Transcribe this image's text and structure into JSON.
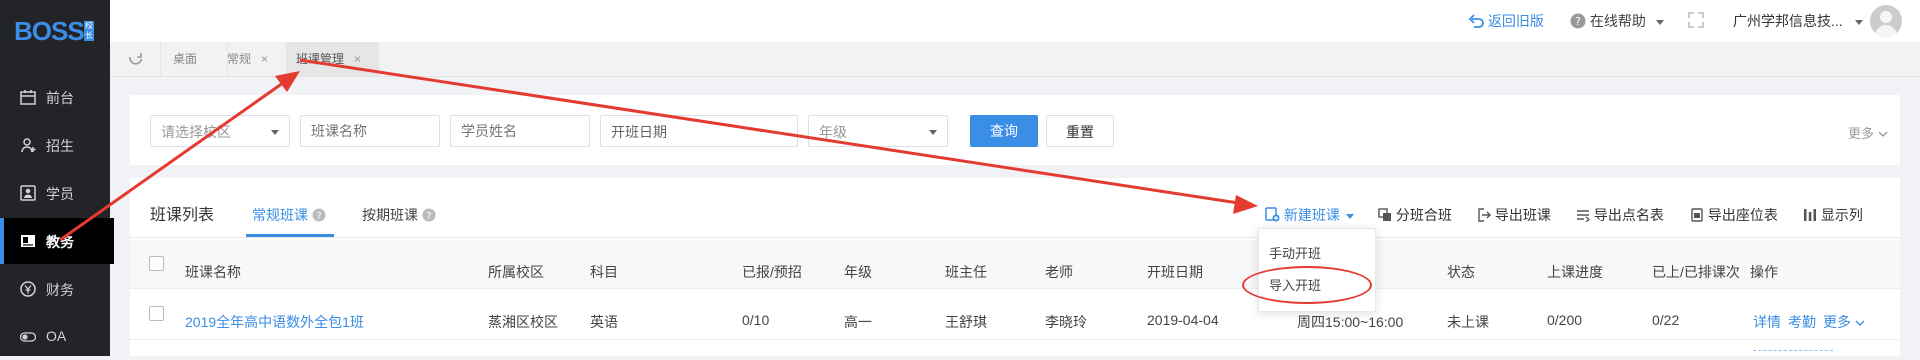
{
  "brand": {
    "logo": "BOSS",
    "seal": "校长",
    "accent": "#3a8ee6"
  },
  "sidebar": {
    "items": [
      {
        "label": "前台",
        "icon": "calendar-icon"
      },
      {
        "label": "招生",
        "icon": "user-add-icon"
      },
      {
        "label": "学员",
        "icon": "student-icon"
      },
      {
        "label": "教务",
        "icon": "academic-icon",
        "active": true
      },
      {
        "label": "财务",
        "icon": "finance-icon"
      },
      {
        "label": "OA",
        "icon": "toggle-icon"
      }
    ]
  },
  "header": {
    "back_label": "返回旧版",
    "help_label": "在线帮助",
    "org_name": "广州学邦信息技..."
  },
  "tabs": [
    {
      "label": "桌面"
    },
    {
      "label": "常规",
      "close": "×"
    },
    {
      "label": "班课管理",
      "close": "×"
    }
  ],
  "filters": {
    "campus_placeholder": "请选择校区",
    "class_name_placeholder": "班课名称",
    "student_name_placeholder": "学员姓名",
    "start_date_placeholder": "开班日期",
    "grade_placeholder": "年级",
    "query_label": "查询",
    "reset_label": "重置",
    "more_label": "更多"
  },
  "list": {
    "title": "班课列表",
    "tabs": [
      {
        "label": "常规班课",
        "active": true
      },
      {
        "label": "按期班课"
      }
    ],
    "toolbar": {
      "new_class": "新建班课",
      "merge": "分班合班",
      "export_class": "导出班课",
      "export_roll": "导出点名表",
      "export_seat": "导出座位表",
      "columns": "显示列"
    },
    "dropdown": {
      "manual": "手动开班",
      "import": "导入开班"
    },
    "columns": [
      "班课名称",
      "所属校区",
      "科目",
      "已报/预招",
      "年级",
      "班主任",
      "老师",
      "开班日期",
      "状态",
      "上课进度",
      "已上/已排课次",
      "操作"
    ],
    "row": {
      "name": "2019全年高中语数外全包1班",
      "campus": "蒸湘区校区",
      "subject": "英语",
      "enrolled": "0/10",
      "grade": "高一",
      "head_teacher": "王舒琪",
      "teacher": "李晓玲",
      "start_date": "2019-04-04",
      "schedule": "周四15:00~16:00",
      "status": "未上课",
      "progress": "0/200",
      "sessions": "0/22",
      "actions": {
        "detail": "详情",
        "attendance": "考勤",
        "more": "更多"
      }
    }
  }
}
